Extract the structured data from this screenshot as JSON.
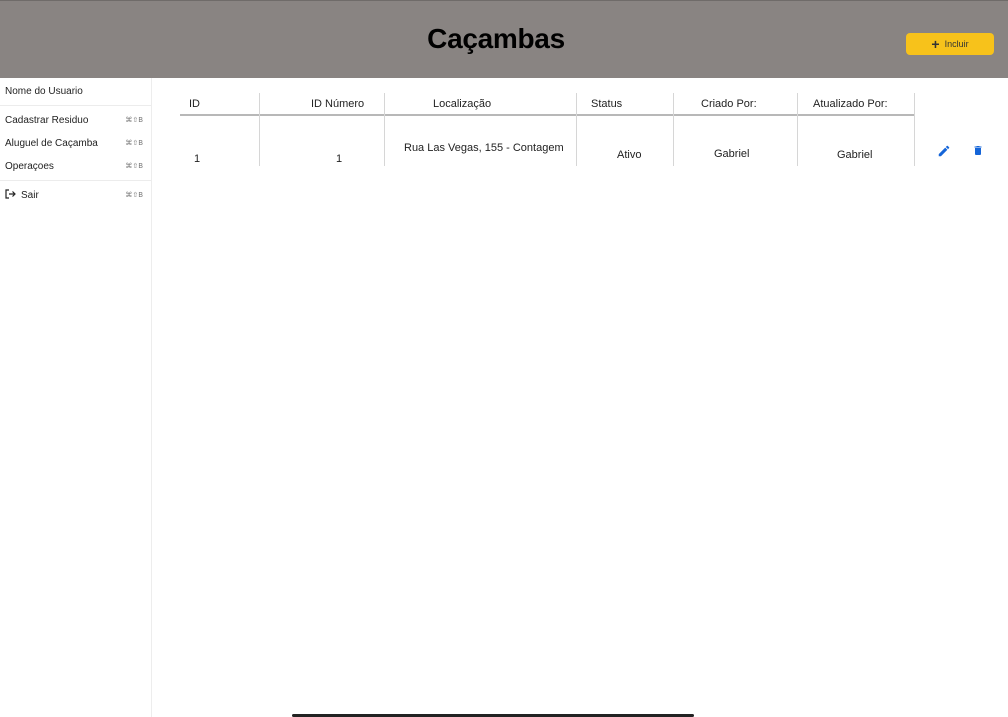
{
  "header": {
    "title": "Caçambas",
    "add_button": {
      "icon": "+",
      "label": "Incluir"
    },
    "colors": {
      "background": "#898482",
      "accent": "#f7c21b"
    }
  },
  "sidebar": {
    "user_name": "Nome do Usuario",
    "items": [
      {
        "label": "Cadastrar Residuo",
        "shortcut": "⌘⇧B"
      },
      {
        "label": "Aluguel de Caçamba",
        "shortcut": "⌘⇧B"
      },
      {
        "label": "Operaçoes",
        "shortcut": "⌘⇧B"
      }
    ],
    "logout": {
      "icon": "logout-icon",
      "label": "Sair",
      "shortcut": "⌘⇧B"
    }
  },
  "table": {
    "columns": [
      "ID",
      "ID Número",
      "Localização",
      "Status",
      "Criado Por:",
      "Atualizado Por:"
    ],
    "rows": [
      {
        "id": "1",
        "id_numero": "1",
        "localizacao": "Rua Las Vegas, 155 - Contagem",
        "status": "Ativo",
        "criado_por": "Gabriel",
        "atualizado_por": "Gabriel"
      }
    ],
    "row_actions": [
      "edit-icon",
      "delete-icon"
    ],
    "action_color": "#1565d8"
  }
}
